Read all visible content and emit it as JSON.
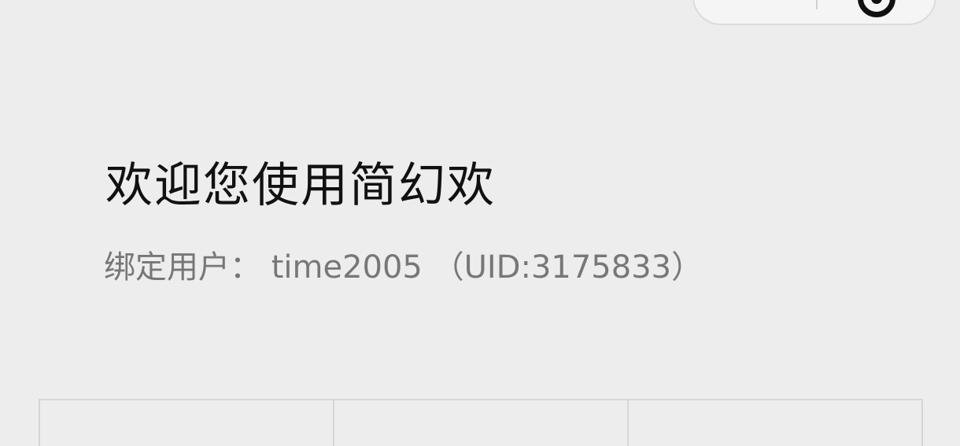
{
  "header": {
    "title": "",
    "capsule": {
      "more_icon": "more-dots-icon",
      "close_icon": "circle-close-icon"
    }
  },
  "welcome": {
    "title": "欢迎您使用简幻欢",
    "bound_user": "绑定用户： time2005 （UID:3175833）"
  },
  "grid": {
    "cells": [
      {
        "label": ""
      },
      {
        "label": ""
      },
      {
        "label": ""
      }
    ]
  },
  "colors": {
    "background": "#ededed",
    "title_text": "#111111",
    "subtitle_text": "#777777",
    "grid_border": "#d6d6d6"
  }
}
